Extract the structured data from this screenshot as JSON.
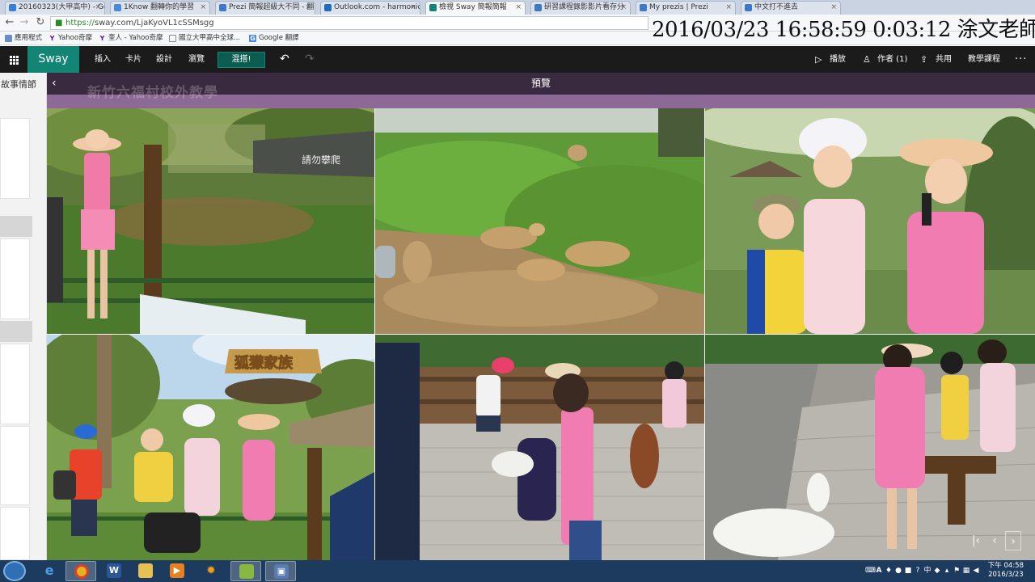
{
  "browser": {
    "tabs": [
      {
        "title": "20160323(大甲高中) - Go",
        "color": "#3b7ed8"
      },
      {
        "title": "1Know 翻轉你的學習",
        "color": "#4a8ad6"
      },
      {
        "title": "Prezi 簡報超級大不同 - 翻",
        "color": "#3d79c6"
      },
      {
        "title": "Outlook.com - harmonio",
        "color": "#1e6bbf"
      },
      {
        "title": "檢視 Sway 簡報簡報",
        "color": "#128575"
      },
      {
        "title": "研習課程錄影影片看存分",
        "color": "#3d79c6"
      },
      {
        "title": "My prezis | Prezi",
        "color": "#3d79c6"
      },
      {
        "title": "中文打不進去",
        "color": "#3d79c6"
      }
    ],
    "url_scheme": "https://",
    "url_rest": "sway.com/LjaKyoVL1cSSMsgg",
    "bookmarks": [
      "應用程式",
      "Yahoo奇摩",
      "奎人 - Yahoo奇摩",
      "國立大甲高中全球...",
      "Google 翻譯"
    ]
  },
  "overlay": {
    "timestamp": "2016/03/23 16:58:59 0:03:12 涂文老師"
  },
  "sway": {
    "logo": "Sway",
    "menu": [
      "插入",
      "卡片",
      "設計",
      "瀏覽"
    ],
    "remix": "混搭!",
    "right": {
      "play": "播放",
      "authors": "作者 (1)",
      "share": "共用",
      "tutorial": "教學課程"
    }
  },
  "preview": {
    "title": "預覽",
    "ghost_title": "新竹六福村校外教學"
  },
  "left_pane": {
    "label": "故事情節"
  },
  "photos": [
    {
      "name": "photo-girl-at-meerkat-fence",
      "sign_text": "請勿攀爬"
    },
    {
      "name": "photo-meerkats-grass"
    },
    {
      "name": "photo-three-kids-hats"
    },
    {
      "name": "photo-kids-raccoon-family-sign",
      "sign_text": "狐獴家族"
    },
    {
      "name": "photo-kids-petting-goats"
    },
    {
      "name": "photo-girl-white-goat"
    }
  ],
  "taskbar": {
    "apps": [
      "Internet Explorer",
      "Google Chrome",
      "Microsoft Word",
      "File Explorer",
      "Media Player",
      "Paw app",
      "Android app",
      "Save app"
    ],
    "clock_time": "下午 04:58",
    "clock_date": "2016/3/23"
  }
}
